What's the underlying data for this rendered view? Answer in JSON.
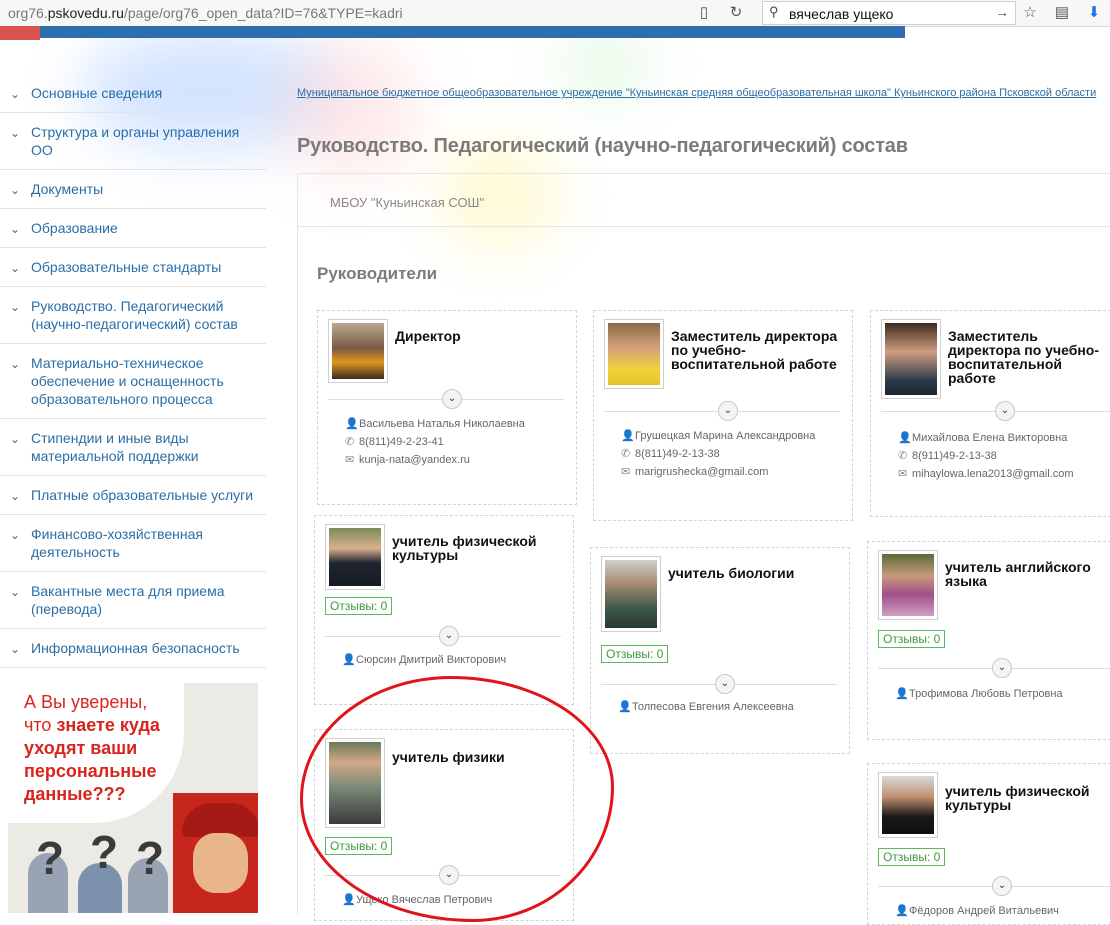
{
  "browser": {
    "url_prefix": "org76.",
    "url_domain": "pskovedu.ru",
    "url_rest": "/page/org76_open_data?ID=76&TYPE=kadri",
    "search_value": "вячеслав ущеко"
  },
  "sidebar": {
    "items": [
      {
        "label": "Основные сведения"
      },
      {
        "label": "Структура и органы управления ОО"
      },
      {
        "label": "Документы"
      },
      {
        "label": "Образование"
      },
      {
        "label": "Образовательные стандарты"
      },
      {
        "label": "Руководство. Педагогический (научно-педагогический) состав"
      },
      {
        "label": "Материально-техническое обеспечение и оснащенность образовательного процесса"
      },
      {
        "label": "Стипендии и иные виды материальной поддержки"
      },
      {
        "label": "Платные образовательные услуги"
      },
      {
        "label": "Финансово-хозяйственная деятельность"
      },
      {
        "label": "Вакантные места для приема (перевода)"
      },
      {
        "label": "Информационная безопасность"
      }
    ]
  },
  "ad": {
    "line1": "А Вы уверены,",
    "line2_a": "что ",
    "line2_b": "знаете куда",
    "line3": "уходят ваши",
    "line4": "персональные",
    "line5": "данные???"
  },
  "main": {
    "org_link": "Муниципальное бюджетное общеобразовательное учреждение \"Куньинская средняя общеобразовательная школа\" Куньинского района Псковской области",
    "page_title": "Руководство. Педагогический (научно-педагогический) состав",
    "tab": "МБОУ \"Куньинская СОШ\"",
    "section_title": "Руководители",
    "reviews_label": "Отзывы: 0"
  },
  "cards": {
    "director": {
      "role": "Директор",
      "name": "Васильева Наталья Николаевна",
      "phone": "8(811)49-2-23-41",
      "email": "kunja-nata@yandex.ru"
    },
    "deputy1": {
      "role": "Заместитель директора по учебно-воспитательной работе",
      "name": "Грушецкая Марина Александровна",
      "phone": "8(811)49-2-13-38",
      "email": "marigrushecka@gmail.com"
    },
    "deputy2": {
      "role": "Заместитель директора по учебно-воспитательной работе",
      "name": "Михайлова Елена Викторовна",
      "phone": "8(911)49-2-13-38",
      "email": "mihaylowa.lena2013@gmail.com"
    },
    "pe1": {
      "role": "учитель физической культуры",
      "name": "Сюрсин Дмитрий Викторович"
    },
    "bio": {
      "role": "учитель биологии",
      "name": "Толпесова Евгения Алексеевна"
    },
    "eng": {
      "role": "учитель английского языка",
      "name": "Трофимова Любовь Петровна"
    },
    "phys": {
      "role": "учитель физики",
      "name": "Ущеко Вячеслав Петрович"
    },
    "pe2": {
      "role": "учитель физической культуры",
      "name": "Фёдоров Андрей Витальевич"
    }
  }
}
